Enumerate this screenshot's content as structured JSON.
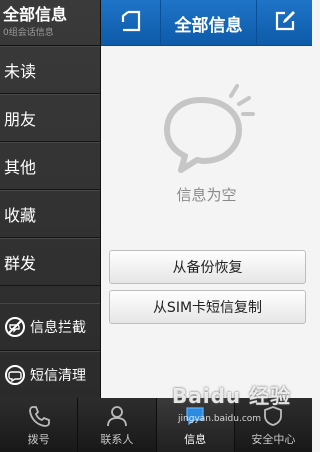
{
  "sidebar": {
    "title": "全部信息",
    "subtitle": "0组会话信息",
    "items": [
      {
        "label": "未读"
      },
      {
        "label": "朋友"
      },
      {
        "label": "其他"
      },
      {
        "label": "收藏"
      },
      {
        "label": "群发"
      }
    ],
    "tools": [
      {
        "label": "信息拦截",
        "icon": "block-message-icon"
      },
      {
        "label": "短信清理",
        "icon": "clean-message-icon"
      }
    ]
  },
  "topbar": {
    "title": "全部信息",
    "left_icon": "back-panel-icon",
    "right_icon": "compose-icon"
  },
  "content": {
    "empty_text": "信息为空",
    "restore_button": "从备份恢复",
    "copy_sim_button": "从SIM卡短信复制"
  },
  "bottomnav": {
    "items": [
      {
        "label": "拨号",
        "icon": "dial-icon",
        "active": false
      },
      {
        "label": "联系人",
        "icon": "contacts-icon",
        "active": false
      },
      {
        "label": "信息",
        "icon": "messages-icon",
        "active": true
      },
      {
        "label": "安全中心",
        "icon": "security-icon",
        "active": false
      }
    ]
  },
  "watermark": {
    "text": "Baidu 经验",
    "sub": "jingyan.baidu.com"
  },
  "colors": {
    "topbar": "#1a6cc0",
    "sidebar": "#333333",
    "background": "#f4f4f4"
  }
}
